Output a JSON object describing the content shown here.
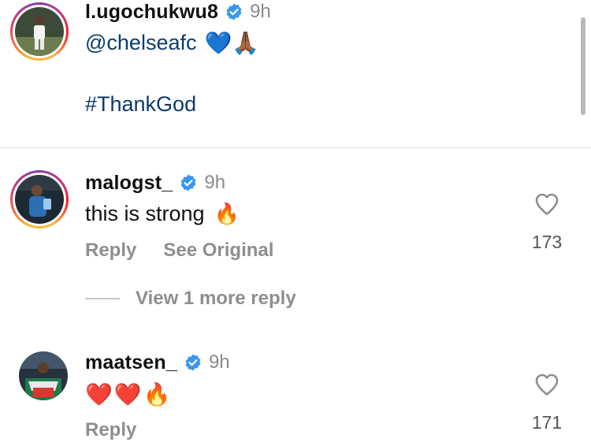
{
  "post": {
    "username": "l.ugochukwu8",
    "time": "9h",
    "mention": "@chelseafc",
    "emojis": "💙🙏🏾",
    "hashtag": "#ThankGod"
  },
  "comments": [
    {
      "username": "malogst_",
      "time": "9h",
      "text": "this is strong",
      "emoji": "🔥",
      "reply_label": "Reply",
      "see_original_label": "See Original",
      "like_count": "173",
      "view_replies_label": "View 1 more reply"
    },
    {
      "username": "maatsen_",
      "time": "9h",
      "text": "",
      "emoji": "❤️❤️🔥",
      "reply_label": "Reply",
      "like_count": "171"
    }
  ],
  "colors": {
    "verified": "#3897f0",
    "link": "#0b3b6b",
    "secondary_text": "#8e8e8e"
  },
  "icons": [
    "verified-badge-icon",
    "heart-outline-icon"
  ]
}
